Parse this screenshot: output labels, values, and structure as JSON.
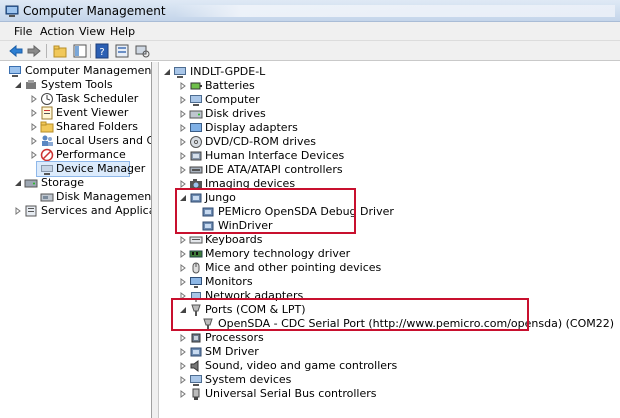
{
  "window": {
    "title": "Computer Management"
  },
  "menu": {
    "file": "File",
    "action": "Action",
    "view": "View",
    "help": "Help"
  },
  "left_tree": {
    "root": "Computer Management (Local",
    "system_tools": "System Tools",
    "task_scheduler": "Task Scheduler",
    "event_viewer": "Event Viewer",
    "shared_folders": "Shared Folders",
    "local_users": "Local Users and Groups",
    "performance": "Performance",
    "device_manager": "Device Manager",
    "storage": "Storage",
    "disk_management": "Disk Management",
    "services": "Services and Applications"
  },
  "device_tree": {
    "computer_name": "INDLT-GPDE-L",
    "items": [
      "Batteries",
      "Computer",
      "Disk drives",
      "Display adapters",
      "DVD/CD-ROM drives",
      "Human Interface Devices",
      "IDE ATA/ATAPI controllers",
      "Imaging devices",
      "Jungo",
      "PEMicro OpenSDA Debug Driver",
      "WinDriver",
      "Keyboards",
      "Memory technology driver",
      "Mice and other pointing devices",
      "Monitors",
      "Network adapters",
      "Ports (COM & LPT)",
      "OpenSDA - CDC Serial Port (http://www.pemicro.com/opensda) (COM22)",
      "Processors",
      "SM Driver",
      "Sound, video and game controllers",
      "System devices",
      "Universal Serial Bus controllers"
    ]
  },
  "colors": {
    "highlight": "#c8102e",
    "selection": "#cce8ff"
  }
}
